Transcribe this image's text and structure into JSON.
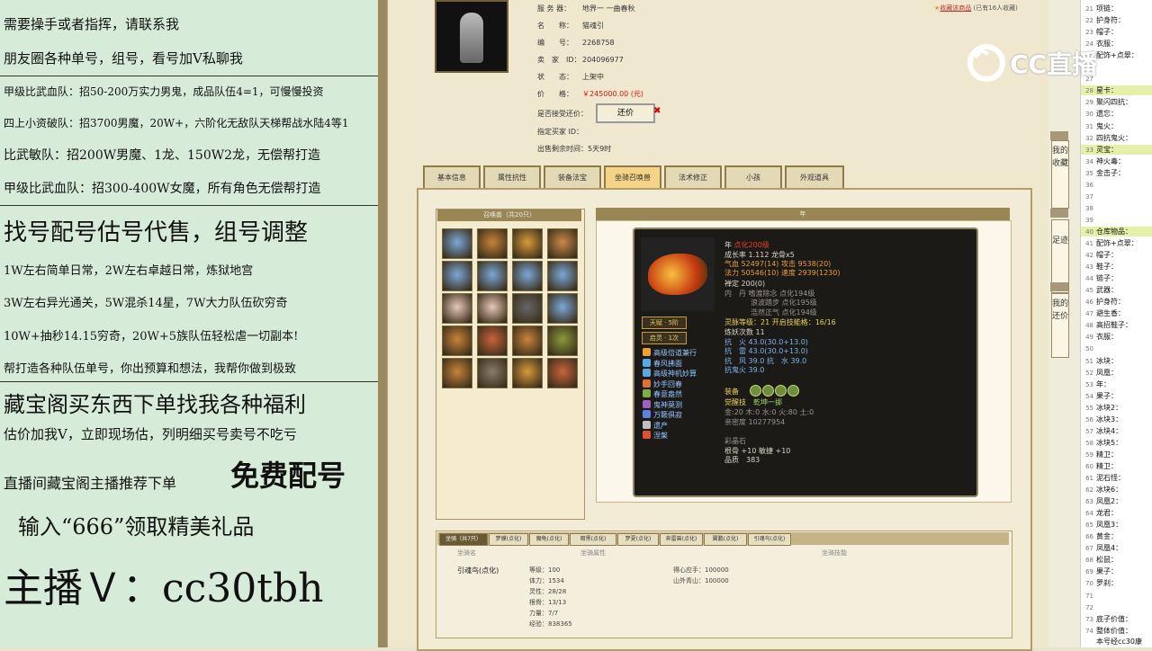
{
  "overlay": {
    "lines": [
      "需要操手或者指挥，请联系我",
      "朋友圈各种单号，组号，看号加Ⅴ私聊我",
      "甲级比武血队：招50-200万实力男鬼，成品队伍4=1，可慢慢投资",
      "四上小资破队：招3700男魔，20W+，六阶化无敌队天梯帮战水陆4等1",
      "比武敏队：招200W男魔、1龙、150W2龙，无偿帮打造",
      "甲级比武血队：招300-400W女魔，所有角色无偿帮打造",
      "找号配号估号代售，组号调整",
      "1W左右简单日常，2W左右卓越日常，炼狱地宫",
      "3W左右异光通关，5W混杀14星，7W大力队伍砍穷奇",
      "10W+抽秒14.15穷奇，20W+5族队伍轻松虐一切副本!",
      "帮打造各种队伍单号，你出预算和想法，我帮你做到极致",
      "藏宝阁买东西下单找我各种福利",
      "估价加我V，立即现场估，列明细买号卖号不吃亏",
      "直播间藏宝阁主播推荐下单",
      "免费配号",
      "输入“666”领取精美礼品",
      "主播Ｖ：cc30tbh"
    ]
  },
  "listing": {
    "server_label": "服 务 器：",
    "server": "地界一 一曲春秋",
    "name_label": "名　　称：",
    "name": "猫魂引",
    "id_label": "编　　号：",
    "id": "2268758",
    "seller_label": "卖　家　ID：",
    "seller": "204096977",
    "status_label": "状　　态：",
    "status": "上架中",
    "price_label": "价　　格：",
    "price": "￥245000.00 (元)",
    "bargain_label": "是否接受还价：",
    "bargain_button": "还价",
    "buyer_label": "指定买家 ID：",
    "time_label": "出售剩余时间：",
    "time": "5天9时",
    "fav": "收藏该商品",
    "fav_count": "(已有16人收藏)"
  },
  "tabs": [
    "基本信息",
    "属性抗性",
    "装备法宝",
    "坐骑召唤兽",
    "法术修正",
    "小孩",
    "外观道具"
  ],
  "pets": {
    "header": "召唤兽（共20只）",
    "colors": [
      "#7aa8d8",
      "#c8833a",
      "#d89a3a",
      "#c88a4a",
      "#7aa8d8",
      "#7aa8d8",
      "#7aa8d8",
      "#7aa8d8",
      "#e8c8b8",
      "#e8c8b8",
      "#666666",
      "#7aa8d8",
      "#c8833a",
      "#c8633a",
      "#c8833a",
      "#8a9a3a",
      "#c8833a",
      "#8a7a6a",
      "#d89a3a",
      "#c8633a"
    ]
  },
  "detail": {
    "header": "年",
    "name": "年",
    "level": "点化200级",
    "growth": "成长率 1.112 龙骨x5",
    "hp": "气血 52497(14) 攻击 9538(20)",
    "mp": "法力 50546(10) 速度 2939(1230)",
    "focus": "禅定 200(0)",
    "inner": "内　丹 嗜渡除念 点化194级",
    "inner2": "浪波踏步 点化195级",
    "inner3": "浩然正气 点化194级",
    "talent_badge": "天赋 · 5阶",
    "feedback_badge": "启灵 · 1次",
    "spirit": "灵脉等级：21 开启技能格：16/16",
    "refine": "炼妖次数 11",
    "res1": "抗　火 43.0(30.0+13.0)",
    "res2": "抗　雷 43.0(30.0+13.0)",
    "res3": "抗　风 39.0 抗　水 39.0",
    "res4": "抗鬼火 39.0",
    "equip_label": "装备",
    "awaken": "觉醒技",
    "awaken_skill": "乾坤一掷",
    "stones": "金:20 木:0 水:0 火:80 土:0",
    "exp": "亲密度 10277954",
    "gem_label": "彩晶石",
    "gem1": "根骨 +10 敏捷 +10",
    "gem2": "品质　383",
    "skills": [
      {
        "label": "高级倍道兼行",
        "color": "#f0a030"
      },
      {
        "label": "春风拂面",
        "color": "#5aa8e0"
      },
      {
        "label": "高级神机妙算",
        "color": "#5aa8e0"
      },
      {
        "label": "妙手回春",
        "color": "#e07030"
      },
      {
        "label": "春意盎然",
        "color": "#7ab040"
      },
      {
        "label": "鬼神莫测",
        "color": "#a060c0"
      },
      {
        "label": "万籁俱寂",
        "color": "#6080e0"
      },
      {
        "label": "遗产",
        "color": "#c0c0c0"
      },
      {
        "label": "涅槃",
        "color": "#e05030"
      }
    ]
  },
  "mounts": {
    "tabs": [
      "坐骑（共7只）",
      "梦貘(点化)",
      "魔龟(点化)",
      "暗黑(点化)",
      "梦夏(点化)",
      "奔雷兽(点化)",
      "翼鹏(点化)",
      "引魂鸟(点化)"
    ],
    "col1": "坐骑名",
    "col2": "坐骑属性",
    "col3": "坐骑技能",
    "name": "引魂鸟(点化)",
    "stats": [
      "等级：100",
      "体力：1534",
      "灵性：28/28",
      "根骨：13/13",
      "力量：7/7",
      "经验：838365"
    ],
    "skills": [
      "得心应手：100000",
      "山外青山：100000"
    ]
  },
  "side_buttons": [
    "我的收藏",
    "足迹",
    "我的还价"
  ],
  "right_list": [
    {
      "n": "21",
      "t": "项链：",
      "c": "n"
    },
    {
      "n": "22",
      "t": "护身符：",
      "c": "n"
    },
    {
      "n": "23",
      "t": "帽子：",
      "c": "n"
    },
    {
      "n": "24",
      "t": "衣服：",
      "c": "n"
    },
    {
      "n": "25",
      "t": "配饰+点翠：",
      "c": "n"
    },
    {
      "n": "26",
      "t": "",
      "c": "n"
    },
    {
      "n": "27",
      "t": "",
      "c": "n"
    },
    {
      "n": "28",
      "t": "星卡：",
      "c": "hl"
    },
    {
      "n": "29",
      "t": "聚闪四抗：",
      "c": "n"
    },
    {
      "n": "30",
      "t": "遗忘：",
      "c": "n"
    },
    {
      "n": "31",
      "t": "鬼火：",
      "c": "n"
    },
    {
      "n": "32",
      "t": "四抗鬼火：",
      "c": "n"
    },
    {
      "n": "33",
      "t": "灵宝：",
      "c": "hl"
    },
    {
      "n": "34",
      "t": "神火毒：",
      "c": "n"
    },
    {
      "n": "35",
      "t": "金击子：",
      "c": "n"
    },
    {
      "n": "36",
      "t": "",
      "c": "n"
    },
    {
      "n": "37",
      "t": "",
      "c": "n"
    },
    {
      "n": "38",
      "t": "",
      "c": "n"
    },
    {
      "n": "39",
      "t": "",
      "c": "n"
    },
    {
      "n": "40",
      "t": "仓库物品：",
      "c": "hl"
    },
    {
      "n": "41",
      "t": "配饰+点翠：",
      "c": "n"
    },
    {
      "n": "42",
      "t": "帽子：",
      "c": "n"
    },
    {
      "n": "43",
      "t": "鞋子：",
      "c": "n"
    },
    {
      "n": "44",
      "t": "链子：",
      "c": "n"
    },
    {
      "n": "45",
      "t": "武器：",
      "c": "n"
    },
    {
      "n": "46",
      "t": "护身符：",
      "c": "n"
    },
    {
      "n": "47",
      "t": "避生香：",
      "c": "n"
    },
    {
      "n": "48",
      "t": "高招鞋子：",
      "c": "n"
    },
    {
      "n": "49",
      "t": "衣服：",
      "c": "n"
    },
    {
      "n": "50",
      "t": "",
      "c": "n"
    },
    {
      "n": "51",
      "t": "冰块：",
      "c": "n"
    },
    {
      "n": "52",
      "t": "凤凰：",
      "c": "n"
    },
    {
      "n": "53",
      "t": "年：",
      "c": "n"
    },
    {
      "n": "54",
      "t": "果子：",
      "c": "n"
    },
    {
      "n": "55",
      "t": "冰块2：",
      "c": "n"
    },
    {
      "n": "56",
      "t": "冰块3：",
      "c": "n"
    },
    {
      "n": "57",
      "t": "冰块4：",
      "c": "n"
    },
    {
      "n": "58",
      "t": "冰块5：",
      "c": "n"
    },
    {
      "n": "59",
      "t": "精卫：",
      "c": "n"
    },
    {
      "n": "60",
      "t": "精卫：",
      "c": "n"
    },
    {
      "n": "61",
      "t": "泥石怪：",
      "c": "n"
    },
    {
      "n": "62",
      "t": "冰块6：",
      "c": "n"
    },
    {
      "n": "63",
      "t": "凤凰2：",
      "c": "n"
    },
    {
      "n": "64",
      "t": "龙君：",
      "c": "n"
    },
    {
      "n": "65",
      "t": "凤凰3：",
      "c": "n"
    },
    {
      "n": "66",
      "t": "黄金：",
      "c": "n"
    },
    {
      "n": "67",
      "t": "凤凰4：",
      "c": "n"
    },
    {
      "n": "68",
      "t": "松鼠：",
      "c": "n"
    },
    {
      "n": "69",
      "t": "果子：",
      "c": "n"
    },
    {
      "n": "70",
      "t": "罗刹：",
      "c": "n"
    },
    {
      "n": "71",
      "t": "",
      "c": "n"
    },
    {
      "n": "72",
      "t": "",
      "c": "n"
    },
    {
      "n": "73",
      "t": "底子价值：",
      "c": "n"
    },
    {
      "n": "74",
      "t": "整体价值：",
      "c": "n"
    }
  ],
  "footer_text": "本号经cc30康",
  "logo_text": "CC直播"
}
